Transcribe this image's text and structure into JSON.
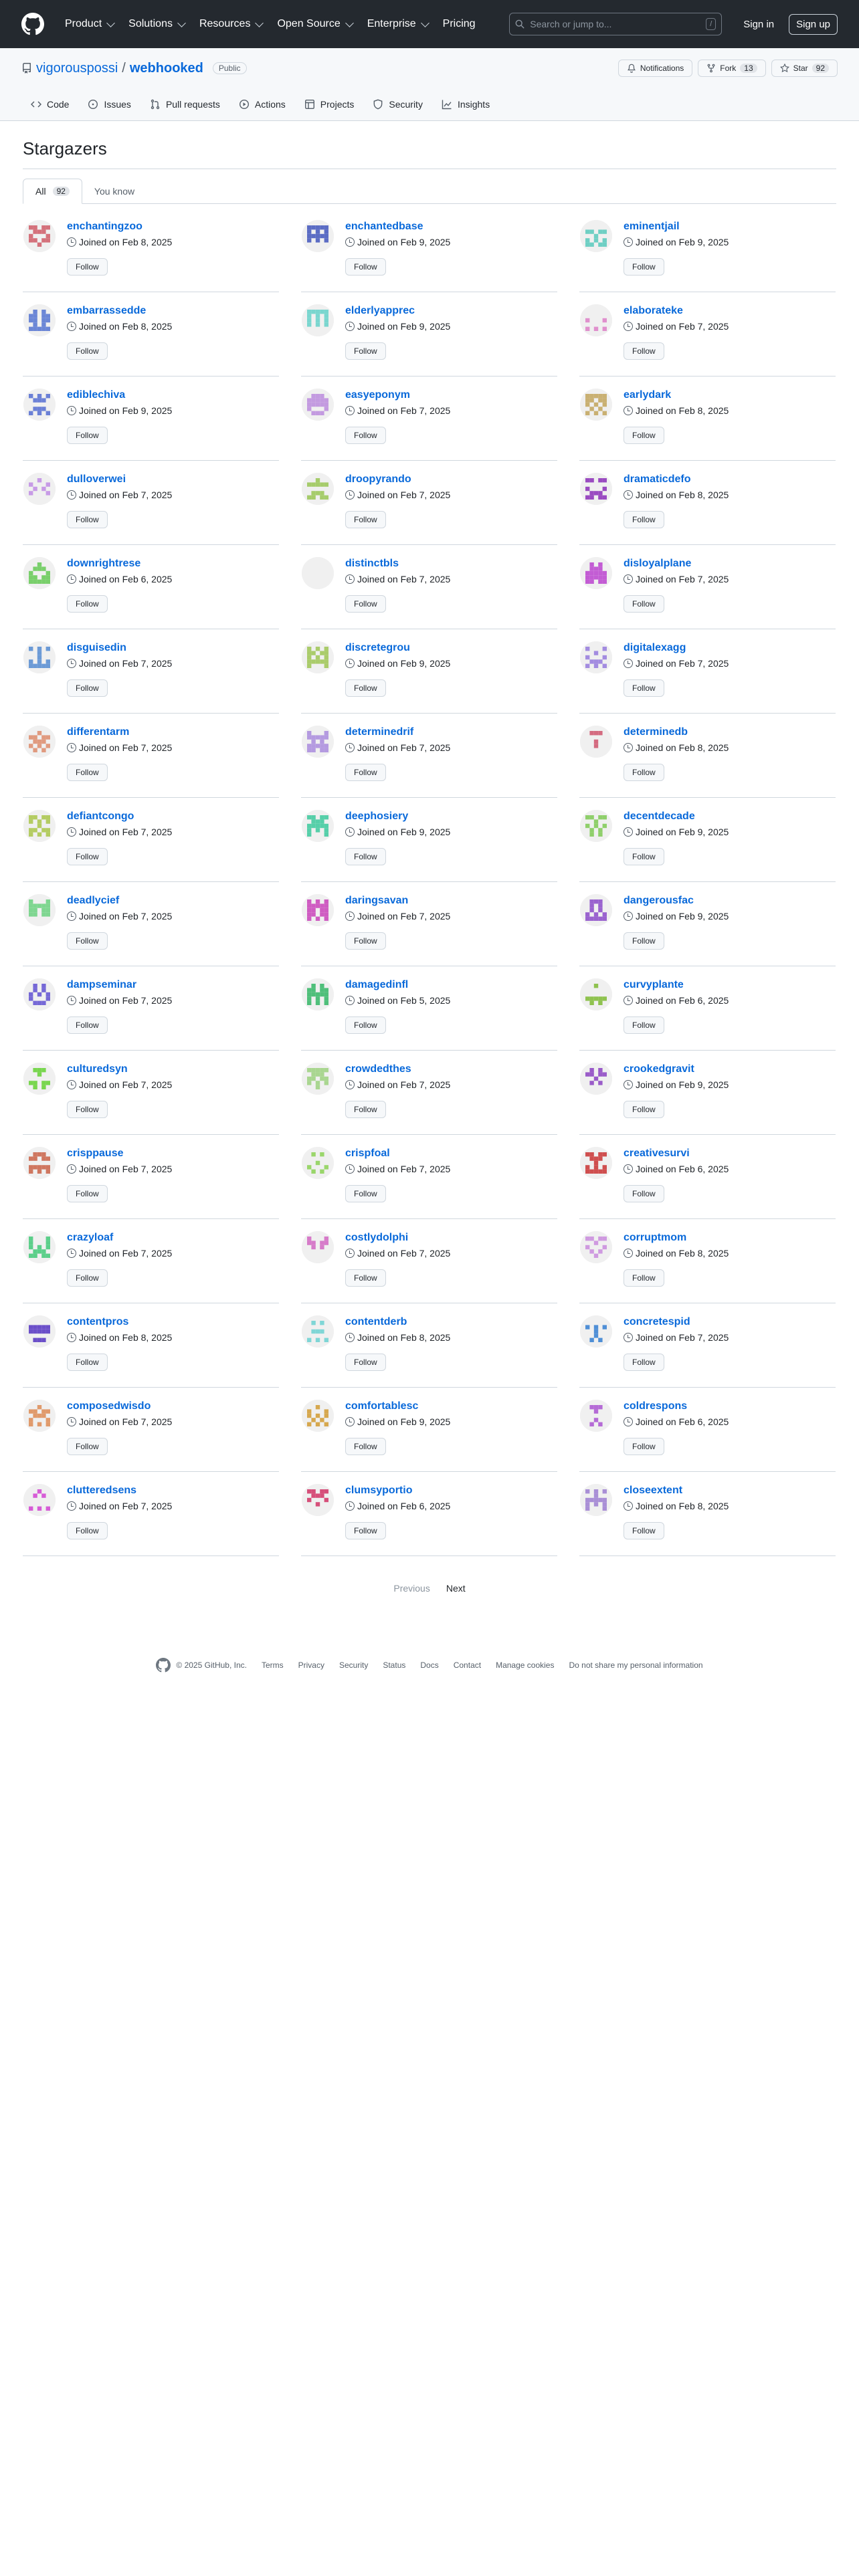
{
  "topbar": {
    "nav": [
      "Product",
      "Solutions",
      "Resources",
      "Open Source",
      "Enterprise",
      "Pricing"
    ],
    "nav_has_chevron": [
      true,
      true,
      true,
      true,
      true,
      false
    ],
    "search_placeholder": "Search or jump to...",
    "search_shortcut": "/",
    "signin": "Sign in",
    "signup": "Sign up"
  },
  "repo": {
    "owner": "vigorouspossi",
    "separator": "/",
    "name": "webhooked",
    "visibility": "Public",
    "notifications": "Notifications",
    "fork": "Fork",
    "fork_count": "13",
    "star": "Star",
    "star_count": "92",
    "tabs": [
      "Code",
      "Issues",
      "Pull requests",
      "Actions",
      "Projects",
      "Security",
      "Insights"
    ]
  },
  "page": {
    "title": "Stargazers",
    "subtabs": [
      {
        "label": "All",
        "count": "92"
      },
      {
        "label": "You know",
        "count": ""
      }
    ]
  },
  "stargazers": [
    {
      "name": "enchantingzoo",
      "joined": "Joined on Feb 8, 2025",
      "color": "#d4717b"
    },
    {
      "name": "enchantedbase",
      "joined": "Joined on Feb 9, 2025",
      "color": "#5b6cc4"
    },
    {
      "name": "eminentjail",
      "joined": "Joined on Feb 9, 2025",
      "color": "#6fcfc4"
    },
    {
      "name": "embarrassedde",
      "joined": "Joined on Feb 8, 2025",
      "color": "#6b86d6"
    },
    {
      "name": "elderlyapprec",
      "joined": "Joined on Feb 9, 2025",
      "color": "#7ad6cf"
    },
    {
      "name": "elaborateke",
      "joined": "Joined on Feb 7, 2025",
      "color": "#e090cd"
    },
    {
      "name": "ediblechiva",
      "joined": "Joined on Feb 9, 2025",
      "color": "#6b80d6"
    },
    {
      "name": "easyeponym",
      "joined": "Joined on Feb 7, 2025",
      "color": "#c39ae0"
    },
    {
      "name": "earlydark",
      "joined": "Joined on Feb 8, 2025",
      "color": "#c9b072"
    },
    {
      "name": "dulloverwei",
      "joined": "Joined on Feb 7, 2025",
      "color": "#c79be6"
    },
    {
      "name": "droopyrando",
      "joined": "Joined on Feb 7, 2025",
      "color": "#a6cc6b"
    },
    {
      "name": "dramaticdefo",
      "joined": "Joined on Feb 8, 2025",
      "color": "#9a4bc1"
    },
    {
      "name": "downrightrese",
      "joined": "Joined on Feb 6, 2025",
      "color": "#79cf6b"
    },
    {
      "name": "distinctbls",
      "joined": "Joined on Feb 7, 2025",
      "color": "#a96bd6"
    },
    {
      "name": "disloyalplane",
      "joined": "Joined on Feb 7, 2025",
      "color": "#c35cd4"
    },
    {
      "name": "disguisedin",
      "joined": "Joined on Feb 7, 2025",
      "color": "#6b9ad6"
    },
    {
      "name": "discretegrou",
      "joined": "Joined on Feb 9, 2025",
      "color": "#aacc6b"
    },
    {
      "name": "digitalexagg",
      "joined": "Joined on Feb 7, 2025",
      "color": "#a38ce0"
    },
    {
      "name": "differentarm",
      "joined": "Joined on Feb 7, 2025",
      "color": "#e09a7f"
    },
    {
      "name": "determinedrif",
      "joined": "Joined on Feb 7, 2025",
      "color": "#b49ae0"
    },
    {
      "name": "determinedb",
      "joined": "Joined on Feb 8, 2025",
      "color": "#d46b80"
    },
    {
      "name": "defiantcongo",
      "joined": "Joined on Feb 7, 2025",
      "color": "#b4cc62"
    },
    {
      "name": "deephosiery",
      "joined": "Joined on Feb 9, 2025",
      "color": "#56cfa9"
    },
    {
      "name": "decentdecade",
      "joined": "Joined on Feb 9, 2025",
      "color": "#8fcf6b"
    },
    {
      "name": "deadlycief",
      "joined": "Joined on Feb 7, 2025",
      "color": "#7ed690"
    },
    {
      "name": "daringsavan",
      "joined": "Joined on Feb 7, 2025",
      "color": "#cf5cc2"
    },
    {
      "name": "dangerousfac",
      "joined": "Joined on Feb 9, 2025",
      "color": "#9a63cf"
    },
    {
      "name": "dampseminar",
      "joined": "Joined on Feb 7, 2025",
      "color": "#7568d6"
    },
    {
      "name": "damagedinfl",
      "joined": "Joined on Feb 5, 2025",
      "color": "#4fbf7a"
    },
    {
      "name": "curvyplante",
      "joined": "Joined on Feb 6, 2025",
      "color": "#8fc24f"
    },
    {
      "name": "culturedsyn",
      "joined": "Joined on Feb 7, 2025",
      "color": "#79d64f"
    },
    {
      "name": "crowdedthes",
      "joined": "Joined on Feb 7, 2025",
      "color": "#a9d690"
    },
    {
      "name": "crookedgravit",
      "joined": "Joined on Feb 9, 2025",
      "color": "#9a5cc9"
    },
    {
      "name": "crisppause",
      "joined": "Joined on Feb 7, 2025",
      "color": "#cf7760"
    },
    {
      "name": "crispfoal",
      "joined": "Joined on Feb 7, 2025",
      "color": "#9ad66b"
    },
    {
      "name": "creativesurvi",
      "joined": "Joined on Feb 6, 2025",
      "color": "#cf4f4f"
    },
    {
      "name": "crazyloaf",
      "joined": "Joined on Feb 7, 2025",
      "color": "#5ccf8a"
    },
    {
      "name": "costlydolphi",
      "joined": "Joined on Feb 7, 2025",
      "color": "#d67bc9"
    },
    {
      "name": "corruptmom",
      "joined": "Joined on Feb 8, 2025",
      "color": "#cf9ae0"
    },
    {
      "name": "contentpros",
      "joined": "Joined on Feb 8, 2025",
      "color": "#6b4fc9"
    },
    {
      "name": "contentderb",
      "joined": "Joined on Feb 8, 2025",
      "color": "#7fd6d6"
    },
    {
      "name": "concretespid",
      "joined": "Joined on Feb 7, 2025",
      "color": "#4f8fd6"
    },
    {
      "name": "composedwisdo",
      "joined": "Joined on Feb 7, 2025",
      "color": "#e09a6b"
    },
    {
      "name": "comfortablesc",
      "joined": "Joined on Feb 9, 2025",
      "color": "#d6a84f"
    },
    {
      "name": "coldrespons",
      "joined": "Joined on Feb 6, 2025",
      "color": "#b56bd6"
    },
    {
      "name": "clutteredsens",
      "joined": "Joined on Feb 7, 2025",
      "color": "#d65cd6"
    },
    {
      "name": "clumsyportio",
      "joined": "Joined on Feb 6, 2025",
      "color": "#d64f7a"
    },
    {
      "name": "closeextent",
      "joined": "Joined on Feb 8, 2025",
      "color": "#a98fd6"
    }
  ],
  "follow_label": "Follow",
  "pager": {
    "previous": "Previous",
    "next": "Next"
  },
  "footer": {
    "copyright": "© 2025 GitHub, Inc.",
    "links": [
      "Terms",
      "Privacy",
      "Security",
      "Status",
      "Docs",
      "Contact",
      "Manage cookies",
      "Do not share my personal information"
    ]
  }
}
